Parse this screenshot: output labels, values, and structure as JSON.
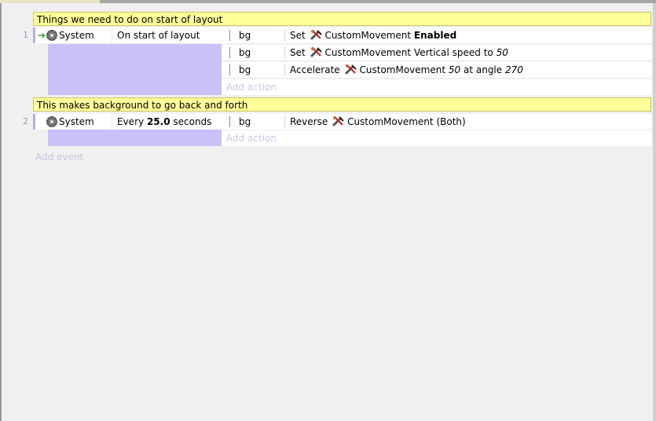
{
  "event_sheet": {
    "blocks": [
      {
        "comment": "Things we need to do on start of layout",
        "event": {
          "number": "1",
          "condition": {
            "object": "System",
            "text": "On start of layout"
          },
          "actions": [
            {
              "object": "bg",
              "verb": "Set",
              "behavior": "CustomMovement",
              "detail_plain": "",
              "detail_bold": "Enabled",
              "detail_italic": "",
              "detail_tail": ""
            },
            {
              "object": "bg",
              "verb": "Set",
              "behavior": "CustomMovement",
              "detail_plain": "Vertical speed to",
              "detail_bold": "",
              "detail_italic": "50",
              "detail_tail": ""
            },
            {
              "object": "bg",
              "verb": "Accelerate",
              "behavior": "CustomMovement",
              "detail_plain": "",
              "detail_bold": "",
              "detail_italic": "50",
              "detail_tail": "at angle",
              "detail_italic2": "270"
            }
          ]
        }
      },
      {
        "comment": "This makes background to go back and forth",
        "event": {
          "number": "2",
          "condition": {
            "object": "System",
            "text_pre": "Every",
            "text_bold": "25.0",
            "text_post": "seconds"
          },
          "actions": [
            {
              "object": "bg",
              "verb": "Reverse",
              "behavior": "CustomMovement",
              "detail_plain": "(Both)"
            }
          ]
        }
      }
    ],
    "add_action_label": "Add action",
    "add_event_label": "Add event"
  },
  "colors": {
    "comment_bg": "#ffff99",
    "condition_filler": "#c9c1f8",
    "event_number": "#9999cc",
    "trigger_arrow": "#2e9a1a"
  },
  "icons": [
    "trigger-arrow-icon",
    "system-gear-icon",
    "behavior-wrench-icon"
  ]
}
